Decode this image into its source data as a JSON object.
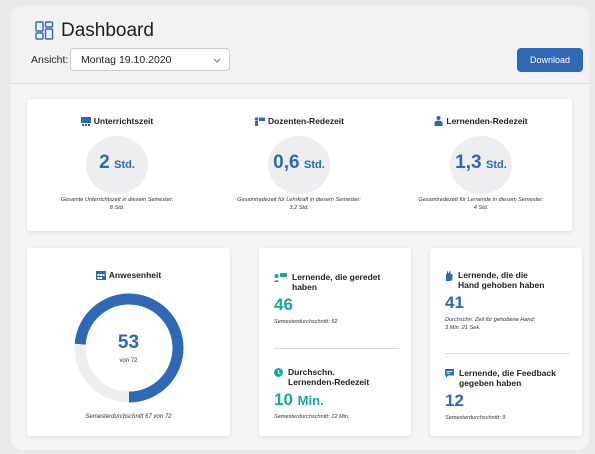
{
  "header": {
    "title": "Dashboard",
    "view_label": "Ansicht:",
    "view_value": "Montag 19.10.2020",
    "download_label": "Download"
  },
  "stats": [
    {
      "title": "Unterrichtszeit",
      "value": "2",
      "unit": "Std.",
      "note": "Gesamte Unterrichtszeit in diesem Semester:",
      "note2": "8 Std.",
      "icon": "classroom-icon"
    },
    {
      "title": "Dozenten-Redezeit",
      "value": "0,6",
      "unit": "Std.",
      "note": "Gesamtredezeit für Lehrkraft in diesem Semester:",
      "note2": "3,2 Std.",
      "icon": "teacher-icon"
    },
    {
      "title": "Lernenden-Redezeit",
      "value": "1,3",
      "unit": "Std.",
      "note": "Gesamtredezeit für Lernende in diesem Semester:",
      "note2": "4 Std.",
      "icon": "learners-icon"
    }
  ],
  "attendance": {
    "title": "Anwesenheit",
    "value": "53",
    "of": "von 72",
    "present": 53,
    "total": 72,
    "note": "Semesterdurchschnitt 67 von 72",
    "icon": "calendar-icon"
  },
  "middle": {
    "spoken": {
      "title": "Lernende, die geredet haben",
      "value": "46",
      "note": "Semesterdurchschnitt: 52",
      "icon": "speech-people-icon"
    },
    "avg_talk": {
      "title_line1": "Durchschn.",
      "title_line2": "Lernenden-Redezeit",
      "value": "10",
      "unit": "Min.",
      "note": "Semesterdurchschnitt: 12 Min.",
      "icon": "clock-icon"
    }
  },
  "right": {
    "hand": {
      "title_line1": "Lernende, die die",
      "title_line2": "Hand gehoben haben",
      "value": "41",
      "note": "Durchschn. Zeit für gehobene Hand:",
      "note2": "3 Min. 21 Sek.",
      "icon": "raised-hand-icon"
    },
    "feedback": {
      "title_line1": "Lernende, die Feedback",
      "title_line2": "gegeben haben",
      "value": "12",
      "note": "Semesterdurchschnitt: 9",
      "icon": "feedback-icon"
    }
  },
  "colors": {
    "accent": "#2f68b5",
    "teal": "#1aa6a0",
    "ring_track": "#eceef0"
  }
}
